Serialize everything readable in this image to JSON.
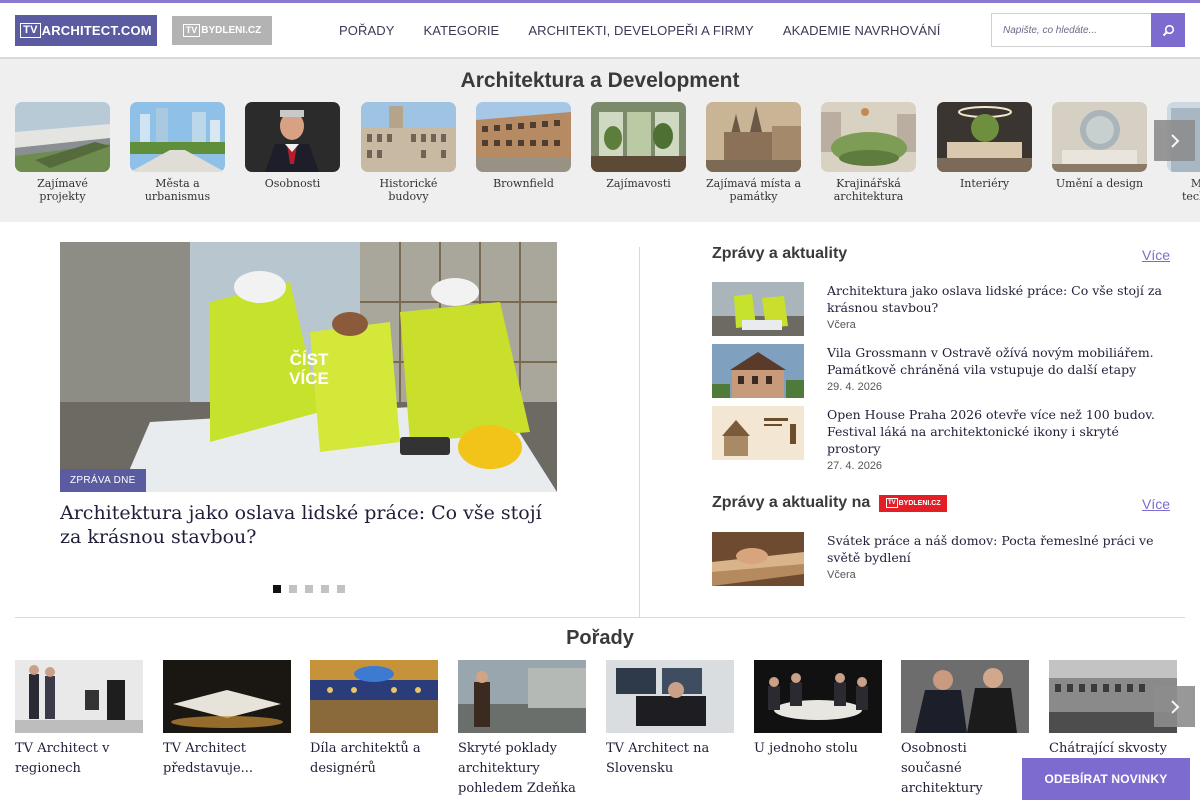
{
  "header": {
    "logo_main": {
      "prefix": "TV",
      "text": "ARCHITECT.COM"
    },
    "logo_alt": {
      "prefix": "TV",
      "text": "BYDLENI.CZ"
    },
    "nav": [
      "POŘADY",
      "KATEGORIE",
      "ARCHITEKTI, DEVELOPEŘI A FIRMY",
      "AKADEMIE NAVRHOVÁNÍ"
    ],
    "search_placeholder": "Napište, co hledáte...",
    "search_icon": "search-icon"
  },
  "categories": {
    "title": "Architektura a Development",
    "items": [
      "Zajímavé projekty",
      "Města a urbanismus",
      "Osobnosti",
      "Historické budovy",
      "Brownfield",
      "Zajímavosti",
      "Zajímavá místa a památky",
      "Krajinářská architektura",
      "Interiéry",
      "Umění a design",
      "Moderní technologie"
    ],
    "next_icon": "chevron-right-icon"
  },
  "hero": {
    "cta": "ČÍST VÍCE",
    "badge": "ZPRÁVA DNE",
    "title": "Architektura jako oslava lidské práce: Co vše stojí za krásnou stavbou?",
    "dots_count": 5,
    "active_dot": 1
  },
  "news": {
    "title": "Zprávy a aktuality",
    "more": "Více",
    "items": [
      {
        "title": "Architektura jako oslava lidské práce: Co vše stojí za krásnou stavbou?",
        "date": "Včera"
      },
      {
        "title": "Vila Grossmann v Ostravě ožívá novým mobiliářem. Památkově chráněná vila vstupuje do další etapy",
        "date": "29. 4. 2026"
      },
      {
        "title": "Open House Praha 2026 otevře více než 100 budov. Festival láká na architektonické ikony i skryté prostory",
        "date": "27. 4. 2026"
      }
    ]
  },
  "news_partner": {
    "title": "Zprávy a aktuality na",
    "logo_prefix": "TV",
    "logo_text": "BYDLENI.CZ",
    "more": "Více",
    "items": [
      {
        "title": "Svátek práce a náš domov: Pocta řemeslné práci ve světě bydlení",
        "date": "Včera"
      }
    ]
  },
  "shows": {
    "title": "Pořady",
    "items": [
      "TV Architect v regionech",
      "TV Architect představuje...",
      "Díla architektů a designérů",
      "Skryté poklady architektury pohledem Zdeňka",
      "TV Architect na Slovensku",
      "U jednoho stolu",
      "Osobnosti současné architektury",
      "Chátrající skvosty"
    ],
    "next_icon": "chevron-right-icon"
  },
  "subscribe_label": "ODEBÍRAT NOVINKY",
  "colors": {
    "brand": "#5b5ba1",
    "accent": "#7d6bd0",
    "partner_red": "#e31e24"
  }
}
